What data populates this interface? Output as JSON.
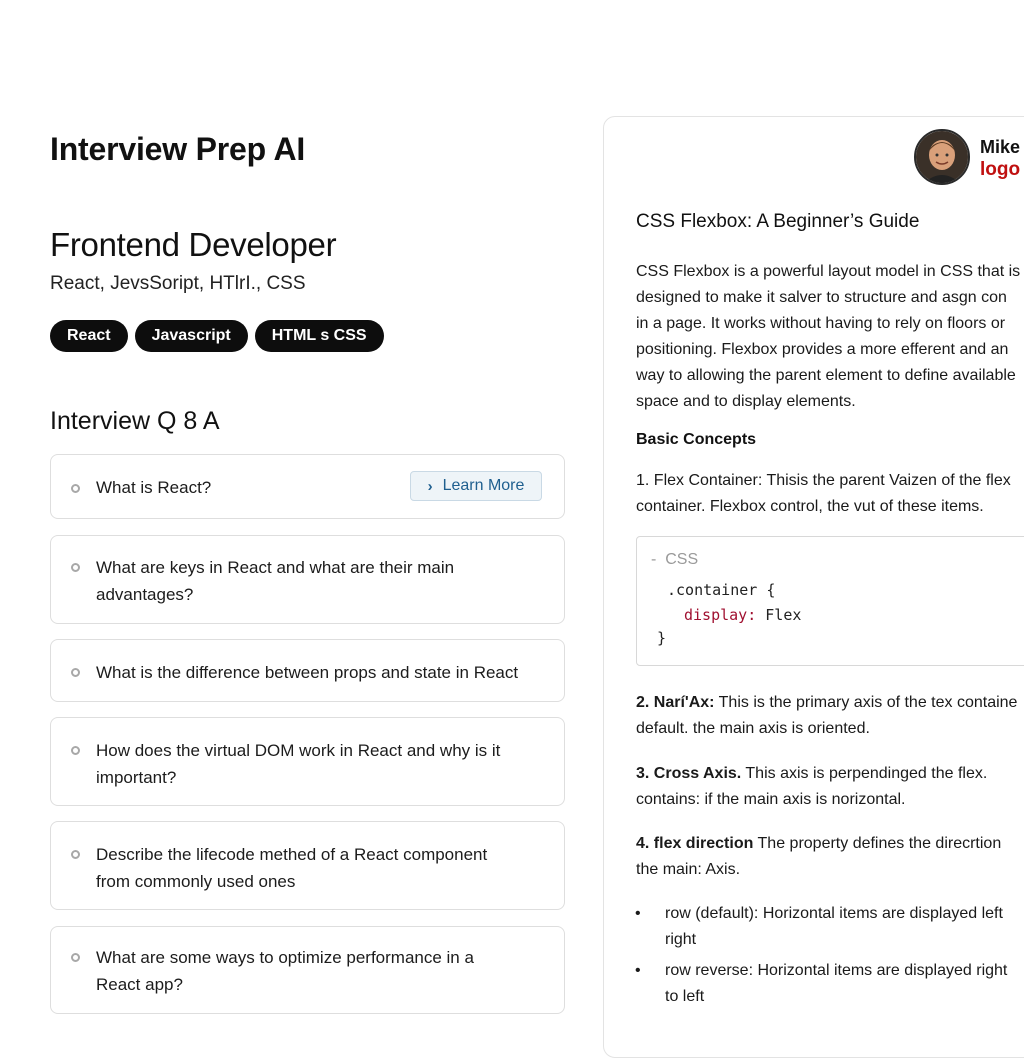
{
  "app": {
    "title": "Interview Prep AI"
  },
  "role": {
    "title": "Frontend Developer",
    "subtitle": "React, JevsSoript, HTlrI., CSS",
    "tags": [
      "React",
      "Javascript",
      "HTML s CSS"
    ]
  },
  "qa": {
    "heading": "Interview Q 8 A",
    "learn_more_label": "Learn More",
    "questions": [
      "What is React?",
      "What are keys in React and what are their main advantages?",
      "What is the difference between props and state in React",
      "How does the virtual DOM work in React and why is it important?",
      "Describe the lifecode methed of a React component from commonly used ones",
      "What are some ways to optimize performance in a React app?"
    ]
  },
  "user": {
    "name": "Mike",
    "logo_text": "logo"
  },
  "article": {
    "title": "CSS Flexbox: A Beginner’s Guide",
    "intro": [
      "CSS Flexbox is a powerful layout model in CSS that is",
      "designed to make it salver to structure and asgn con",
      "in a page. It works without having to rely on floors or",
      "positioning. Flexbox provides a more efferent and an",
      "way to allowing the parent element to define available",
      "space and to display elements."
    ],
    "basic_heading": "Basic Concepts",
    "concept1": [
      "1. Flex Container: Thisis the parent Vaizen of the flex",
      "container. Flexbox control,  the vut of these items."
    ],
    "code": {
      "lang": "CSS",
      "line1": ".container {",
      "prop": "display:",
      "value": " Flex",
      "close": "}"
    },
    "concept2": {
      "bold": "2. Narí'Ax:",
      "rest": " This is the primary axis of the tex containe",
      "line2": "default. the main axis is oriented."
    },
    "concept3": {
      "bold": "3. Cross Axis.",
      "rest": " This axis is perpendinged the flex.",
      "line2": "contains: if the main axis is norizontal."
    },
    "concept4": {
      "bold": "4. flex direction",
      "rest": " The property defines the direcrtion",
      "line2": "the main: Axis."
    },
    "bullets": [
      {
        "line1": "row (default): Horizontal items are displayed left",
        "line2": "right"
      },
      {
        "line1": "row reverse: Horizontal items are displayed right",
        "line2": "to left"
      }
    ]
  }
}
